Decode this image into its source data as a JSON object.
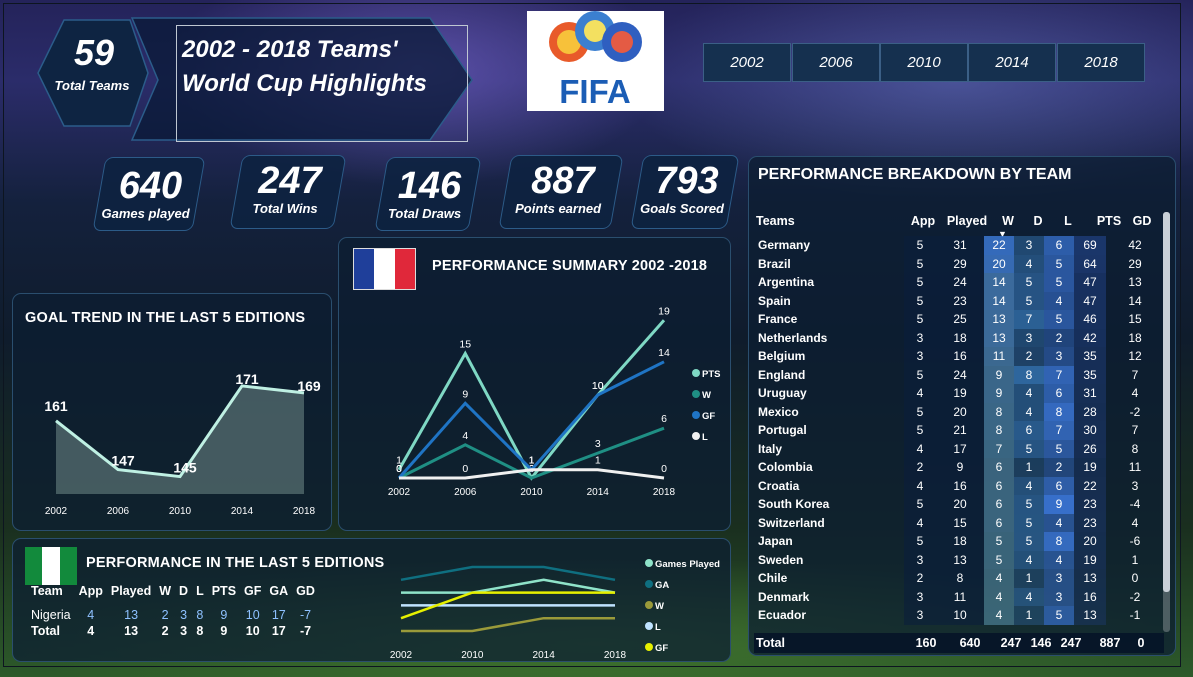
{
  "header": {
    "total_teams": {
      "value": "59",
      "label": "Total Teams"
    },
    "title_line1": "2002 - 2018 Teams'",
    "title_line2": "World Cup Highlights",
    "logo_text": "FIFA",
    "years": [
      "2002",
      "2006",
      "2010",
      "2014",
      "2018"
    ]
  },
  "kpis": [
    {
      "value": "640",
      "label": "Games played"
    },
    {
      "value": "247",
      "label": "Total Wins"
    },
    {
      "value": "146",
      "label": "Total Draws"
    },
    {
      "value": "887",
      "label": "Points earned"
    },
    {
      "value": "793",
      "label": "Goals Scored"
    }
  ],
  "goal_trend": {
    "title": "GOAL TREND IN THE LAST 5 EDITIONS",
    "chart_data": {
      "type": "area",
      "categories": [
        "2002",
        "2006",
        "2010",
        "2014",
        "2018"
      ],
      "values": [
        161,
        147,
        145,
        171,
        169
      ],
      "title": "GOAL TREND IN THE LAST 5 EDITIONS",
      "ylim": [
        140,
        175
      ],
      "grid": false
    }
  },
  "summary": {
    "title": "PERFORMANCE SUMMARY 2002 -2018",
    "chart_data": {
      "type": "line",
      "categories": [
        "2002",
        "2006",
        "2010",
        "2014",
        "2018"
      ],
      "series": [
        {
          "name": "PTS",
          "values": [
            1,
            15,
            0,
            10,
            19
          ],
          "color": "#7fd8c4"
        },
        {
          "name": "W",
          "values": [
            0,
            4,
            0,
            3,
            6
          ],
          "color": "#1f8f84"
        },
        {
          "name": "GF",
          "values": [
            0,
            9,
            1,
            10,
            14
          ],
          "color": "#1f74c4"
        },
        {
          "name": "L",
          "values": [
            0,
            0,
            1,
            1,
            0
          ],
          "color": "#f0f0f0"
        }
      ],
      "ylim": [
        0,
        20
      ],
      "legend": "right",
      "title": "PERFORMANCE SUMMARY 2002 -2018"
    }
  },
  "breakdown": {
    "title": "PERFORMANCE BREAKDOWN BY TEAM",
    "columns": [
      "Teams",
      "App",
      "Played",
      "W",
      "D",
      "L",
      "PTS",
      "GD"
    ],
    "rows": [
      [
        "Germany",
        "5",
        "31",
        "22",
        "3",
        "6",
        "69",
        "42"
      ],
      [
        "Brazil",
        "5",
        "29",
        "20",
        "4",
        "5",
        "64",
        "29"
      ],
      [
        "Argentina",
        "5",
        "24",
        "14",
        "5",
        "5",
        "47",
        "13"
      ],
      [
        "Spain",
        "5",
        "23",
        "14",
        "5",
        "4",
        "47",
        "14"
      ],
      [
        "France",
        "5",
        "25",
        "13",
        "7",
        "5",
        "46",
        "15"
      ],
      [
        "Netherlands",
        "3",
        "18",
        "13",
        "3",
        "2",
        "42",
        "18"
      ],
      [
        "Belgium",
        "3",
        "16",
        "11",
        "2",
        "3",
        "35",
        "12"
      ],
      [
        "England",
        "5",
        "24",
        "9",
        "8",
        "7",
        "35",
        "7"
      ],
      [
        "Uruguay",
        "4",
        "19",
        "9",
        "4",
        "6",
        "31",
        "4"
      ],
      [
        "Mexico",
        "5",
        "20",
        "8",
        "4",
        "8",
        "28",
        "-2"
      ],
      [
        "Portugal",
        "5",
        "21",
        "8",
        "6",
        "7",
        "30",
        "7"
      ],
      [
        "Italy",
        "4",
        "17",
        "7",
        "5",
        "5",
        "26",
        "8"
      ],
      [
        "Colombia",
        "2",
        "9",
        "6",
        "1",
        "2",
        "19",
        "11"
      ],
      [
        "Croatia",
        "4",
        "16",
        "6",
        "4",
        "6",
        "22",
        "3"
      ],
      [
        "South Korea",
        "5",
        "20",
        "6",
        "5",
        "9",
        "23",
        "-4"
      ],
      [
        "Switzerland",
        "4",
        "15",
        "6",
        "5",
        "4",
        "23",
        "4"
      ],
      [
        "Japan",
        "5",
        "18",
        "5",
        "5",
        "8",
        "20",
        "-6"
      ],
      [
        "Sweden",
        "3",
        "13",
        "5",
        "4",
        "4",
        "19",
        "1"
      ],
      [
        "Chile",
        "2",
        "8",
        "4",
        "1",
        "3",
        "13",
        "0"
      ],
      [
        "Denmark",
        "3",
        "11",
        "4",
        "4",
        "3",
        "16",
        "-2"
      ],
      [
        "Ecuador",
        "3",
        "10",
        "4",
        "1",
        "5",
        "13",
        "-1"
      ]
    ],
    "total": [
      "Total",
      "160",
      "640",
      "247",
      "146",
      "247",
      "887",
      "0"
    ]
  },
  "last5": {
    "title": "PERFORMANCE IN THE LAST 5 EDITIONS",
    "columns": [
      "Team",
      "App",
      "Played",
      "W",
      "D",
      "L",
      "PTS",
      "GF",
      "GA",
      "GD"
    ],
    "rows": [
      [
        "Nigeria",
        "4",
        "13",
        "2",
        "3",
        "8",
        "9",
        "10",
        "17",
        "-7"
      ],
      [
        "Total",
        "4",
        "13",
        "2",
        "3",
        "8",
        "9",
        "10",
        "17",
        "-7"
      ]
    ],
    "chart_data": {
      "type": "line",
      "categories": [
        "2002",
        "2010",
        "2014",
        "2018"
      ],
      "series": [
        {
          "name": "Games Played",
          "values": [
            3,
            3,
            4,
            3
          ],
          "color": "#8fe3c9"
        },
        {
          "name": "GA",
          "values": [
            4,
            5,
            5,
            4
          ],
          "color": "#0f6f80"
        },
        {
          "name": "W",
          "values": [
            0,
            0,
            1,
            1
          ],
          "color": "#9a9a3a"
        },
        {
          "name": "L",
          "values": [
            2,
            2,
            2,
            2
          ],
          "color": "#bfe3ff"
        },
        {
          "name": "GF",
          "values": [
            1,
            3,
            3,
            3
          ],
          "color": "#e6f000"
        }
      ],
      "legend": "right"
    }
  }
}
